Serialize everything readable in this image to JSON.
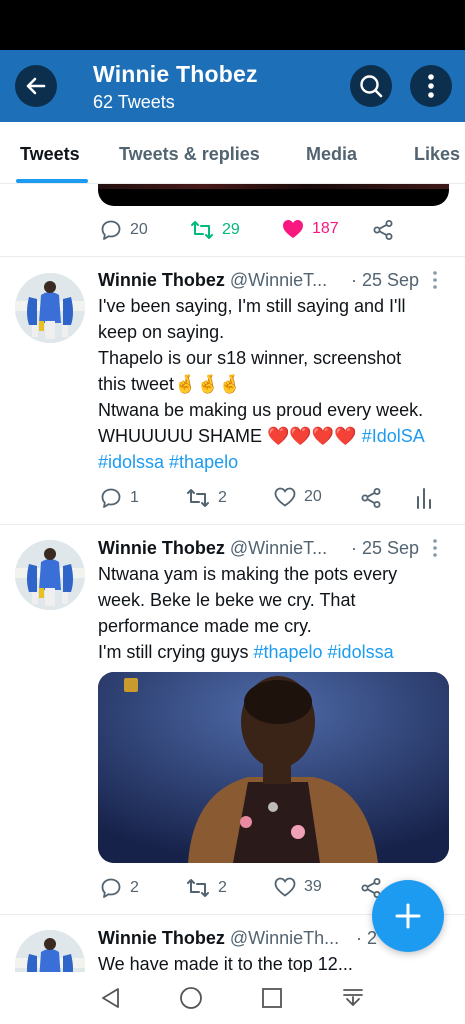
{
  "header": {
    "title": "Winnie Thobez",
    "subtitle": "62 Tweets"
  },
  "tabs": [
    {
      "label": "Tweets",
      "active": true
    },
    {
      "label": "Tweets & replies",
      "active": false
    },
    {
      "label": "Media",
      "active": false
    },
    {
      "label": "Likes",
      "active": false
    }
  ],
  "tweets": [
    {
      "stats": {
        "replies": "20",
        "retweets": "29",
        "likes": "187"
      },
      "liked": true,
      "retweet_color": "#00ba7c",
      "like_color": "#f91880"
    },
    {
      "name": "Winnie Thobez",
      "handle": "@WinnieT...",
      "date": "· 25 Sep",
      "lines": [
        "I've been saying, I'm still saying and I'll",
        "keep on saying.",
        "Thapelo is our s18 winner, screenshot",
        "this tweet",
        "Ntwana be making us proud every week.",
        "WHUUUUU SHAME",
        "#idolssa #thapelo"
      ],
      "emoji_fingers": "🤞🤞🤞",
      "emoji_hearts": "❤️❤️❤️❤️",
      "hashtag_inline": "#IdolSA",
      "stats": {
        "replies": "1",
        "retweets": "2",
        "likes": "20"
      }
    },
    {
      "name": "Winnie Thobez",
      "handle": "@WinnieT...",
      "date": "· 25 Sep",
      "lines": [
        "Ntwana yam is making the pots every",
        "week. Beke le beke we cry. That",
        "performance made me cry.",
        "I'm still crying guys"
      ],
      "hashtags_inline": "#thapelo #idolssa",
      "stats": {
        "replies": "2",
        "retweets": "2",
        "likes": "39"
      }
    },
    {
      "name": "Winnie Thobez",
      "handle": "@WinnieTh...",
      "date": "· 2",
      "lines": [
        "We have made it to the top 12..."
      ]
    }
  ],
  "colors": {
    "header_bg": "#1d70b8",
    "accent": "#1d9bf0",
    "muted": "#536471"
  },
  "icons": [
    "arrow-left-icon",
    "search-icon",
    "more-vertical-icon",
    "reply-icon",
    "retweet-icon",
    "heart-icon",
    "share-icon",
    "analytics-icon",
    "plus-icon",
    "nav-back-icon",
    "nav-home-icon",
    "nav-recents-icon",
    "nav-menu-icon"
  ]
}
